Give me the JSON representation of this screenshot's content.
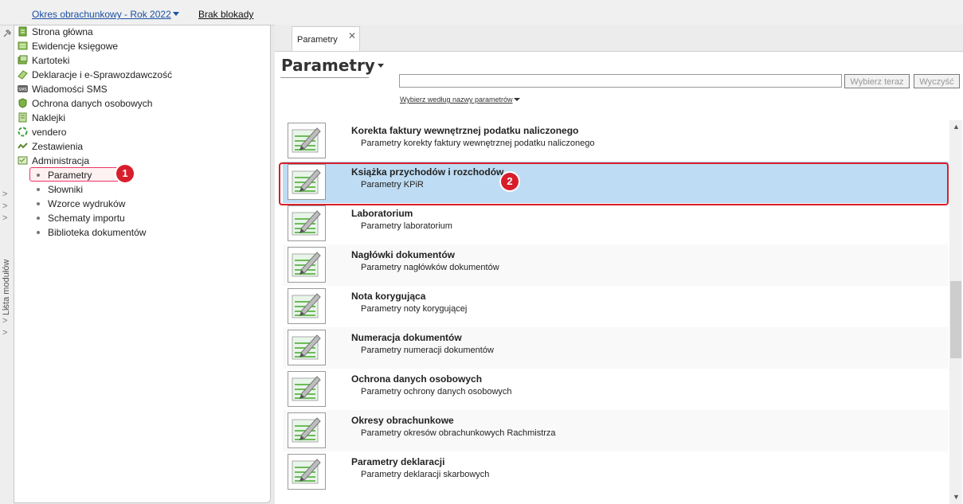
{
  "topbar": {
    "period_link": "Okres obrachunkowy - Rok 2022",
    "lock_status": "Brak blokady"
  },
  "module_strip": {
    "label": "Lista modułów"
  },
  "tree": {
    "items": [
      {
        "label": "Strona główna",
        "icon": "home-icon"
      },
      {
        "label": "Ewidencje księgowe",
        "icon": "ledger-icon"
      },
      {
        "label": "Kartoteki",
        "icon": "cards-icon"
      },
      {
        "label": "Deklaracje i e-Sprawozdawczość",
        "icon": "declaration-icon"
      },
      {
        "label": "Wiadomości SMS",
        "icon": "sms-icon"
      },
      {
        "label": "Ochrona danych osobowych",
        "icon": "shield-icon"
      },
      {
        "label": "Naklejki",
        "icon": "sticker-icon"
      },
      {
        "label": "vendero",
        "icon": "vendero-icon"
      },
      {
        "label": "Zestawienia",
        "icon": "report-icon"
      },
      {
        "label": "Administracja",
        "icon": "admin-icon"
      }
    ],
    "admin_children": [
      {
        "label": "Parametry",
        "selected": true
      },
      {
        "label": "Słowniki"
      },
      {
        "label": "Wzorce wydruków"
      },
      {
        "label": "Schematy importu"
      },
      {
        "label": "Biblioteka dokumentów"
      }
    ]
  },
  "annotations": {
    "badge1": "1",
    "badge2": "2"
  },
  "tab": {
    "label": "Parametry",
    "close": "✕"
  },
  "page": {
    "title": "Parametry",
    "search_value": "",
    "search_button": "Wybierz teraz",
    "clear_button": "Wyczyść",
    "filter_label": "Wybierz według nazwy parametrów"
  },
  "rows": [
    {
      "name": "Korekta faktury wewnętrznej podatku naliczonego",
      "desc": "Parametry korekty faktury wewnętrznej podatku naliczonego"
    },
    {
      "name": "Książka przychodów i rozchodów",
      "desc": "Parametry KPiR",
      "selected": true
    },
    {
      "name": "Laboratorium",
      "desc": "Parametry laboratorium"
    },
    {
      "name": "Nagłówki dokumentów",
      "desc": "Parametry nagłówków dokumentów"
    },
    {
      "name": "Nota korygująca",
      "desc": "Parametry noty korygującej"
    },
    {
      "name": "Numeracja dokumentów",
      "desc": "Parametry numeracji dokumentów"
    },
    {
      "name": "Ochrona danych osobowych",
      "desc": "Parametry ochrony danych osobowych"
    },
    {
      "name": "Okresy obrachunkowe",
      "desc": "Parametry okresów obrachunkowych Rachmistrza"
    },
    {
      "name": "Parametry deklaracji",
      "desc": "Parametry deklaracji skarbowych"
    }
  ],
  "colors": {
    "selection": "#bedcf3",
    "highlight": "#d81e2c",
    "link": "#1a4fa3"
  }
}
